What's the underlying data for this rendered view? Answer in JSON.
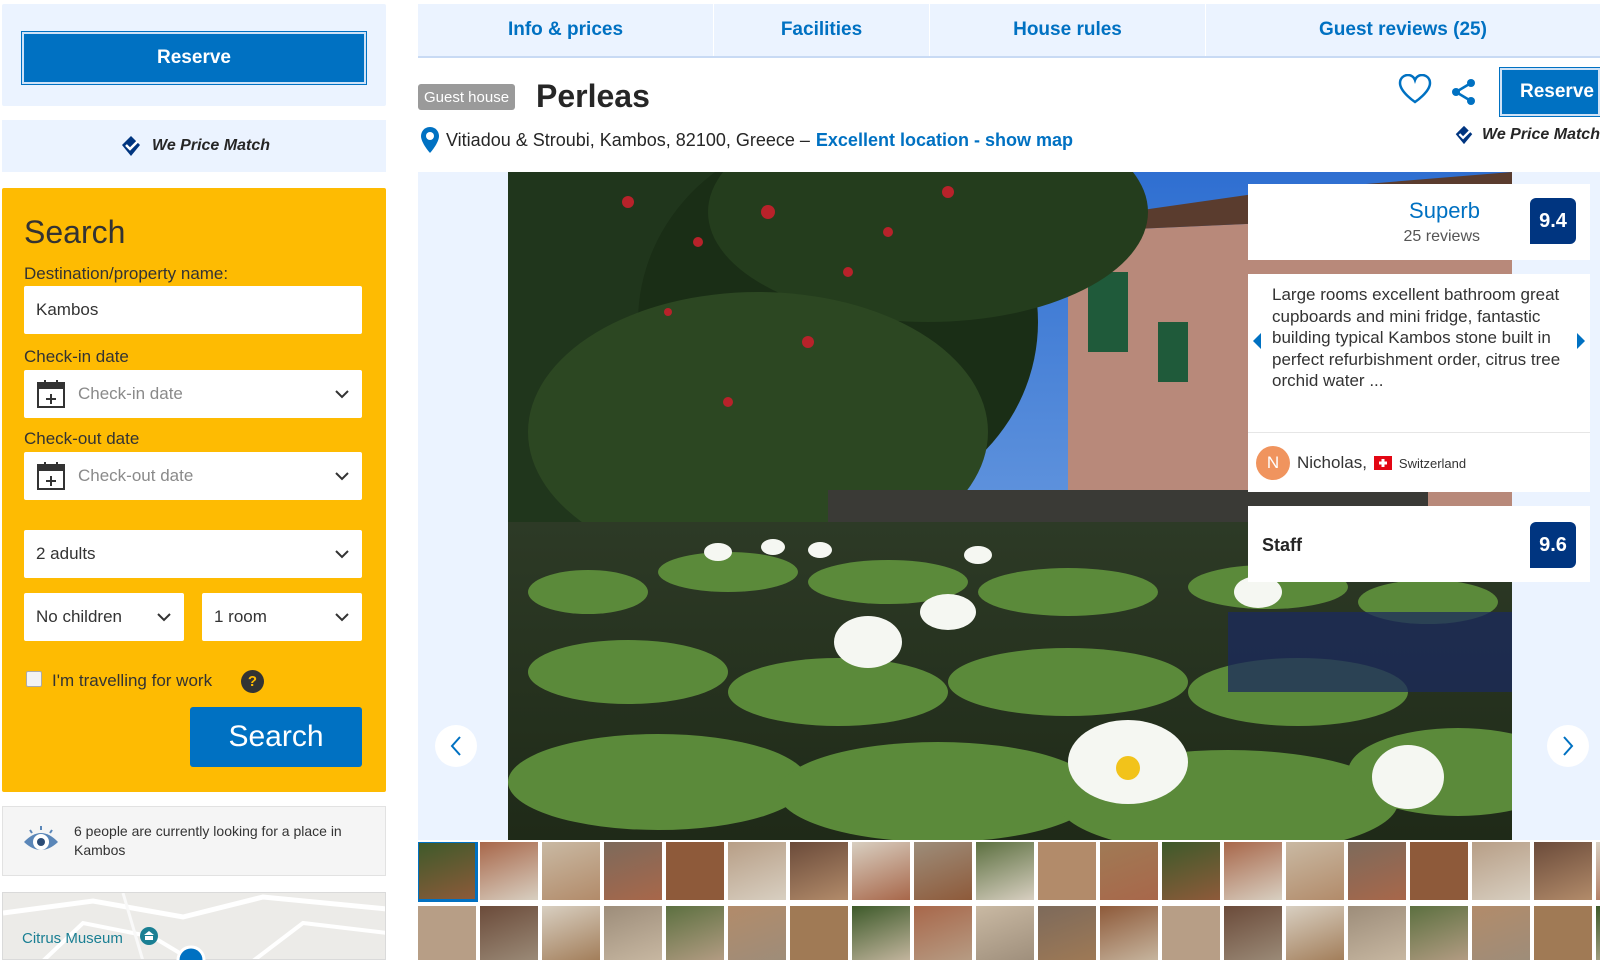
{
  "sidebar": {
    "reserve_label": "Reserve",
    "price_match": "We Price Match",
    "search": {
      "title": "Search",
      "destination_label": "Destination/property name:",
      "destination_value": "Kambos",
      "checkin_label": "Check-in date",
      "checkin_placeholder": "Check-in date",
      "checkout_label": "Check-out date",
      "checkout_placeholder": "Check-out date",
      "adults_value": "2 adults",
      "children_value": "No children",
      "rooms_value": "1 room",
      "work_label": "I'm travelling for work",
      "help_glyph": "?",
      "search_button": "Search"
    },
    "looking_text": "6 people are currently looking for a place in Kambos",
    "map_label": "Citrus Museum"
  },
  "tabs": [
    {
      "label": "Info & prices"
    },
    {
      "label": "Facilities"
    },
    {
      "label": "House rules"
    },
    {
      "label": "Guest reviews (25)"
    }
  ],
  "property": {
    "badge": "Guest house",
    "name": "Perleas",
    "address": "Vitiadou & Stroubi, Kambos, 82100, Greece –",
    "location_link": "Excellent location - show map",
    "reserve_label": "Reserve",
    "price_match": "We Price Match"
  },
  "review": {
    "word": "Superb",
    "count": "25 reviews",
    "score": "9.4",
    "quote": "Large rooms excellent bathroom great cupboards and mini fridge, fantastic building typical Kambos stone built in perfect refurbishment order, citrus tree orchid water ...",
    "reviewer_initial": "N",
    "reviewer_name": "Nicholas,",
    "reviewer_country": "Switzerland",
    "staff_label": "Staff",
    "staff_score": "9.6"
  },
  "colors": {
    "brand_blue": "#0071c2",
    "score_navy": "#003580",
    "search_yellow": "#febb02"
  }
}
